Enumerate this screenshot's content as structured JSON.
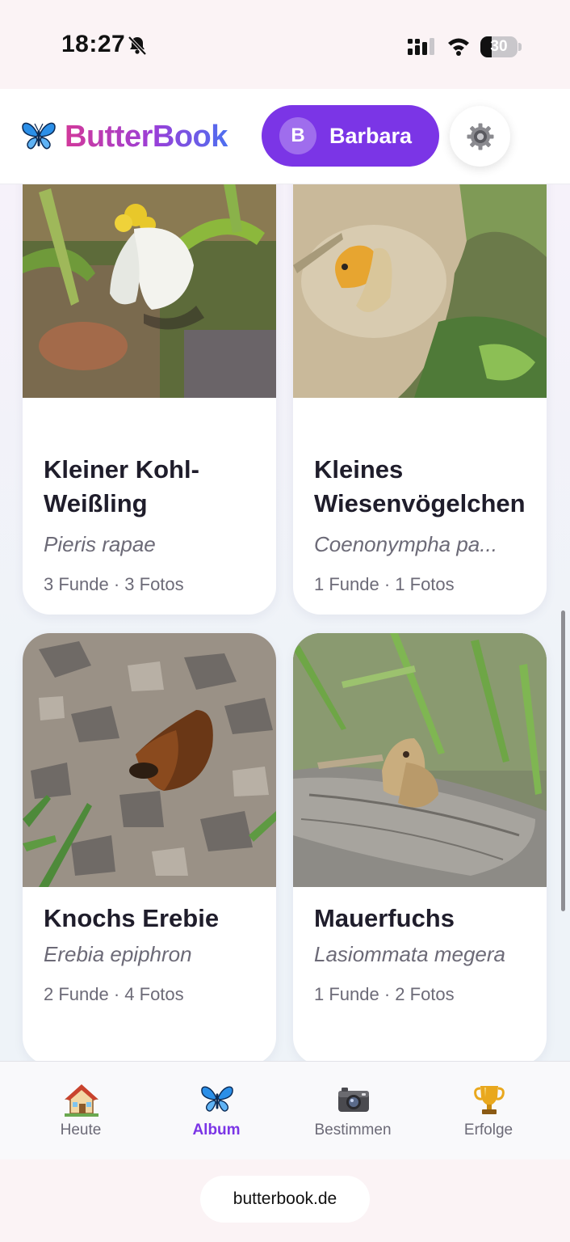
{
  "status_bar": {
    "time": "18:27",
    "battery": "30",
    "battery_level": 0.3
  },
  "header": {
    "brand": "ButterBook",
    "user_initial": "B",
    "user_name": "Barbara"
  },
  "cards": [
    {
      "title": "Kleiner Kohl-\nWeißling",
      "scientific": "Pieris rapae",
      "meta": "3 Funde · 3 Fotos"
    },
    {
      "title": "Kleines\nWiesenvögelchen",
      "scientific": "Coenonympha pa...",
      "meta": "1 Funde · 1 Fotos"
    },
    {
      "title": "Knochs Erebie",
      "scientific": "Erebia epiphron",
      "meta": "2 Funde · 4 Fotos"
    },
    {
      "title": "Mauerfuchs",
      "scientific": "Lasiommata megera",
      "meta": "1 Funde · 2 Fotos"
    }
  ],
  "nav": [
    {
      "label": "Heute",
      "icon": "house-icon"
    },
    {
      "label": "Album",
      "icon": "butterfly-icon",
      "active": true
    },
    {
      "label": "Bestimmen",
      "icon": "camera-icon"
    },
    {
      "label": "Erfolge",
      "icon": "trophy-icon"
    }
  ],
  "browser": {
    "url": "butterbook.de"
  },
  "colors": {
    "accent": "#7b35e6",
    "brand_gradient": [
      "#d2399a",
      "#9a3fd8",
      "#4d6ff0"
    ]
  }
}
